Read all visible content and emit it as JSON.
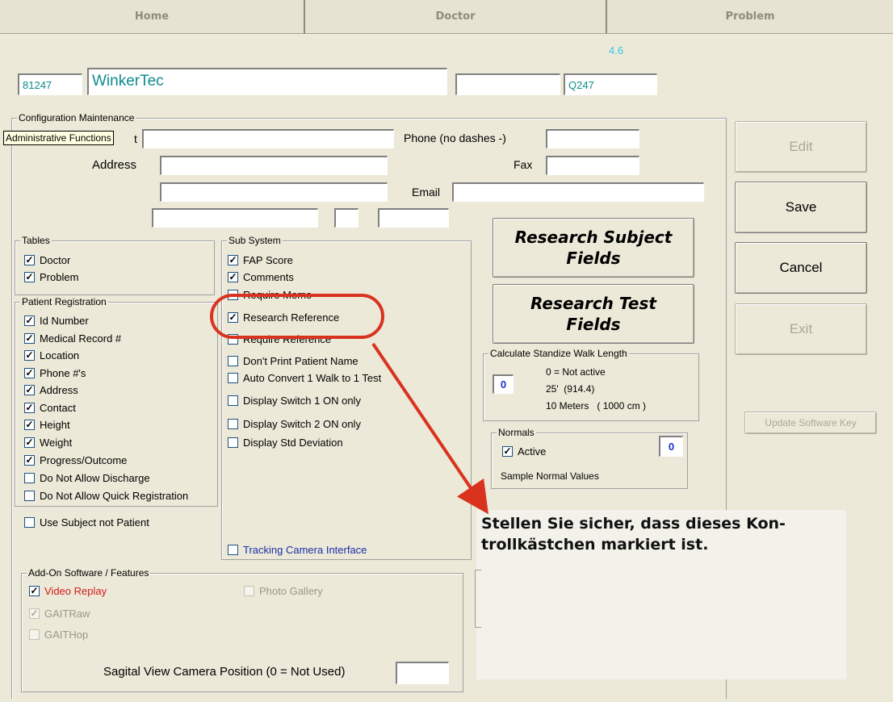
{
  "tabs": {
    "home": "Home",
    "doctor": "Doctor",
    "problem": "Problem"
  },
  "version": "4.6",
  "header": {
    "id_value": "81247",
    "company_value": "WinkerTec",
    "blank_value": "",
    "code_value": "Q247"
  },
  "tooltip": "Administrative Functions",
  "config": {
    "title": "Configuration Maintenance",
    "contact_suffix": "t",
    "phone_label": "Phone (no dashes -)",
    "address_label": "Address",
    "fax_label": "Fax",
    "email_label": "Email"
  },
  "tables": {
    "title": "Tables",
    "items": [
      {
        "label": "Doctor",
        "checked": true
      },
      {
        "label": "Problem",
        "checked": true
      }
    ]
  },
  "patient_registration": {
    "title": "Patient Registration",
    "items": [
      {
        "label": "Id Number",
        "checked": true
      },
      {
        "label": "Medical Record #",
        "checked": true
      },
      {
        "label": "Location",
        "checked": true
      },
      {
        "label": "Phone #'s",
        "checked": true
      },
      {
        "label": "Address",
        "checked": true
      },
      {
        "label": "Contact",
        "checked": true
      },
      {
        "label": "Height",
        "checked": true
      },
      {
        "label": "Weight",
        "checked": true
      },
      {
        "label": "Progress/Outcome",
        "checked": true
      },
      {
        "label": "Do Not Allow Discharge",
        "checked": false
      },
      {
        "label": "Do Not Allow Quick Registration",
        "checked": false
      }
    ]
  },
  "use_subject": {
    "label": "Use Subject not Patient",
    "checked": false
  },
  "sub_system": {
    "title": "Sub System",
    "items": [
      {
        "label": "FAP Score",
        "checked": true
      },
      {
        "label": "Comments",
        "checked": true
      },
      {
        "label": "Require Memo",
        "checked": false
      },
      {
        "label": "Research Reference",
        "checked": true
      },
      {
        "label": "Require Reference",
        "checked": false
      },
      {
        "label": "Don't Print Patient Name",
        "checked": false
      },
      {
        "label": "Auto Convert 1 Walk to 1 Test",
        "checked": false
      },
      {
        "label": "Display Switch 1 ON only",
        "checked": false
      },
      {
        "label": "Display Switch 2 ON only",
        "checked": false
      },
      {
        "label": "Display Std Deviation",
        "checked": false
      }
    ],
    "tracking": {
      "label": "Tracking Camera Interface",
      "checked": false
    }
  },
  "research_buttons": {
    "subject_line1": "Research Subject",
    "subject_line2": "Fields",
    "test_line1": "Research Test",
    "test_line2": "Fields"
  },
  "walk_length": {
    "title": "Calculate Standize Walk Length",
    "value": "0",
    "opt1": "0 = Not active",
    "opt2": "25'  (914.4)",
    "opt3": "10 Meters   ( 1000 cm )"
  },
  "normals": {
    "title": "Normals",
    "active_label": "Active",
    "active_checked": true,
    "value": "0",
    "sample_label": "Sample Normal Values"
  },
  "buttons": {
    "edit": "Edit",
    "save": "Save",
    "cancel": "Cancel",
    "exit": "Exit",
    "update_key": "Update Software Key"
  },
  "addon": {
    "title": "Add-On Software / Features",
    "video_replay": {
      "label": "Video Replay",
      "checked": true
    },
    "gaitraw": {
      "label": "GAITRaw",
      "checked": true
    },
    "gaithop": {
      "label": "GAITHop",
      "checked": false
    },
    "photo_gallery": {
      "label": "Photo Gallery",
      "checked": false
    },
    "sagital_label": "Sagital View Camera Position (0 = Not Used)",
    "sagital_value": ""
  },
  "callout": {
    "text": "Stellen Sie sicher, dass dieses Kon-\ntrollkästchen markiert ist.",
    "accent": "#d9331f"
  }
}
